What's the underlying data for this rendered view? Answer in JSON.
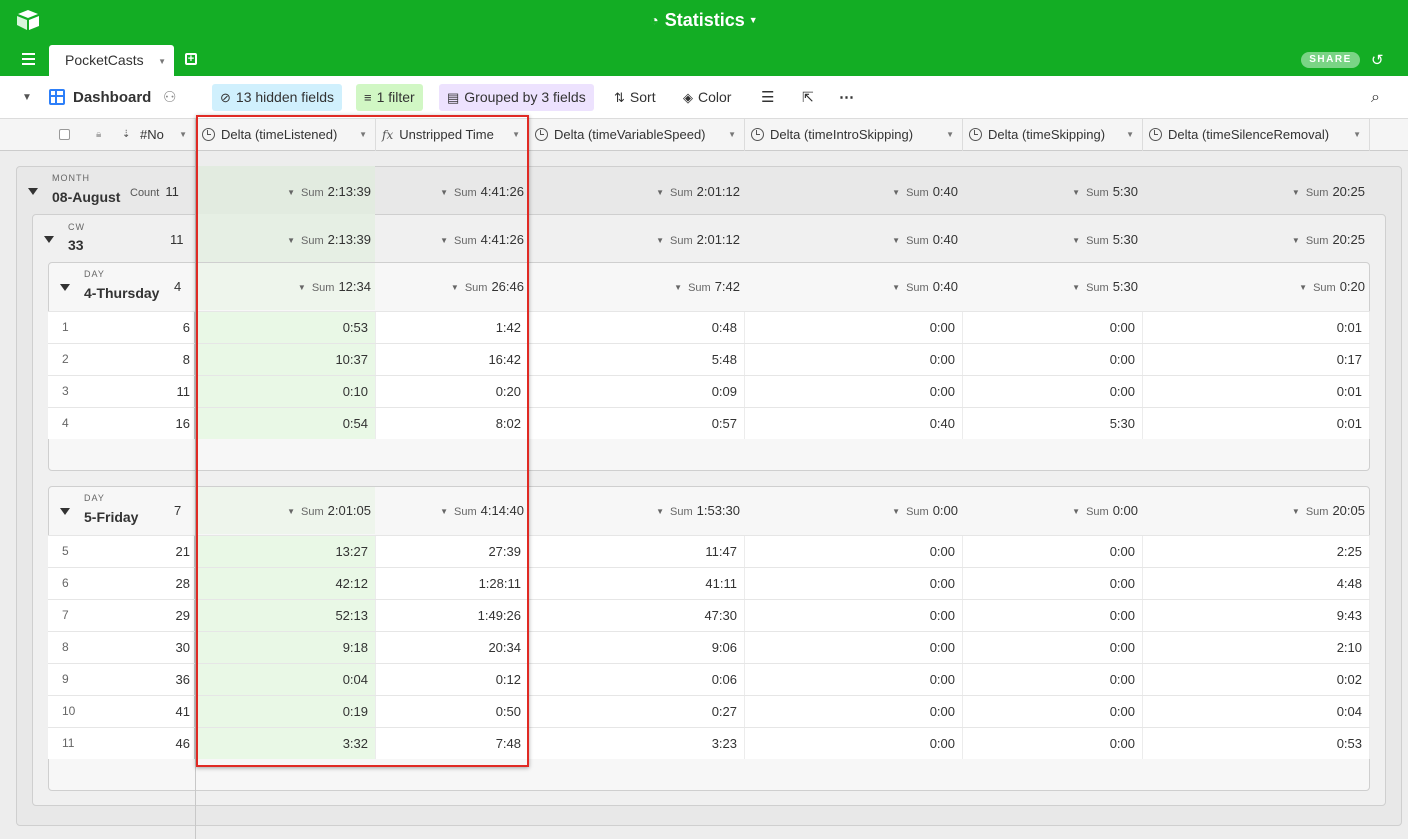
{
  "app": {
    "base_title": "Statistics",
    "tab_label": "PocketCasts",
    "share_label": "SHARE"
  },
  "toolbar": {
    "view_name": "Dashboard",
    "hidden_fields": "13 hidden fields",
    "filter": "1 filter",
    "grouped": "Grouped by 3 fields",
    "sort": "Sort",
    "color": "Color"
  },
  "columns": {
    "no": "#No",
    "delta_listened": "Delta (timeListened)",
    "unstripped": "Unstripped Time",
    "delta_variable": "Delta (timeVariableSpeed)",
    "delta_intro": "Delta (timeIntroSkipping)",
    "delta_skipping": "Delta (timeSkipping)",
    "delta_silence": "Delta (timeSilenceRemoval)"
  },
  "sum_label": "Sum",
  "count_label": "Count",
  "groups": {
    "month": {
      "label": "MONTH",
      "value": "08-August",
      "count": "11",
      "sums": [
        "2:13:39",
        "4:41:26",
        "2:01:12",
        "0:40",
        "5:30",
        "20:25"
      ]
    },
    "cw": {
      "label": "CW",
      "value": "33",
      "count": "11",
      "sums": [
        "2:13:39",
        "4:41:26",
        "2:01:12",
        "0:40",
        "5:30",
        "20:25"
      ]
    },
    "day_a": {
      "label": "DAY",
      "value": "4-Thursday",
      "count": "4",
      "sums": [
        "12:34",
        "26:46",
        "7:42",
        "0:40",
        "5:30",
        "0:20"
      ]
    },
    "day_b": {
      "label": "DAY",
      "value": "5-Friday",
      "count": "7",
      "sums": [
        "2:01:05",
        "4:14:40",
        "1:53:30",
        "0:00",
        "0:00",
        "20:05"
      ]
    }
  },
  "rows_a": [
    {
      "n": "1",
      "no": "6",
      "c": [
        "0:53",
        "1:42",
        "0:48",
        "0:00",
        "0:00",
        "0:01"
      ]
    },
    {
      "n": "2",
      "no": "8",
      "c": [
        "10:37",
        "16:42",
        "5:48",
        "0:00",
        "0:00",
        "0:17"
      ]
    },
    {
      "n": "3",
      "no": "11",
      "c": [
        "0:10",
        "0:20",
        "0:09",
        "0:00",
        "0:00",
        "0:01"
      ]
    },
    {
      "n": "4",
      "no": "16",
      "c": [
        "0:54",
        "8:02",
        "0:57",
        "0:40",
        "5:30",
        "0:01"
      ]
    }
  ],
  "rows_b": [
    {
      "n": "5",
      "no": "21",
      "c": [
        "13:27",
        "27:39",
        "11:47",
        "0:00",
        "0:00",
        "2:25"
      ]
    },
    {
      "n": "6",
      "no": "28",
      "c": [
        "42:12",
        "1:28:11",
        "41:11",
        "0:00",
        "0:00",
        "4:48"
      ]
    },
    {
      "n": "7",
      "no": "29",
      "c": [
        "52:13",
        "1:49:26",
        "47:30",
        "0:00",
        "0:00",
        "9:43"
      ]
    },
    {
      "n": "8",
      "no": "30",
      "c": [
        "9:18",
        "20:34",
        "9:06",
        "0:00",
        "0:00",
        "2:10"
      ]
    },
    {
      "n": "9",
      "no": "36",
      "c": [
        "0:04",
        "0:12",
        "0:06",
        "0:00",
        "0:00",
        "0:02"
      ]
    },
    {
      "n": "10",
      "no": "41",
      "c": [
        "0:19",
        "0:50",
        "0:27",
        "0:00",
        "0:00",
        "0:04"
      ]
    },
    {
      "n": "11",
      "no": "46",
      "c": [
        "3:32",
        "7:48",
        "3:23",
        "0:00",
        "0:00",
        "0:53"
      ]
    }
  ]
}
